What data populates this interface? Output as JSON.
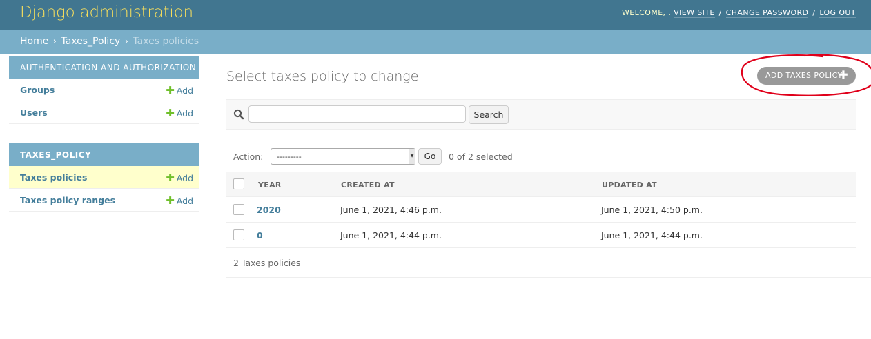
{
  "header": {
    "branding": "Django administration",
    "welcome": "WELCOME, .",
    "view_site": "VIEW SITE",
    "change_password": "CHANGE PASSWORD",
    "log_out": "LOG OUT",
    "separator": "/"
  },
  "breadcrumbs": {
    "home": "Home",
    "app": "Taxes_Policy",
    "current": "Taxes policies",
    "separator": "›"
  },
  "sidebar": {
    "modules": [
      {
        "caption": "AUTHENTICATION AND AUTHORIZATION",
        "items": [
          {
            "label": "Groups",
            "add": "Add"
          },
          {
            "label": "Users",
            "add": "Add"
          }
        ]
      },
      {
        "caption": "TAXES_POLICY",
        "items": [
          {
            "label": "Taxes policies",
            "add": "Add",
            "current": true
          },
          {
            "label": "Taxes policy ranges",
            "add": "Add"
          }
        ]
      }
    ]
  },
  "content": {
    "title": "Select taxes policy to change",
    "add_button": "ADD TAXES POLICY",
    "search": {
      "button": "Search",
      "value": ""
    },
    "actions": {
      "label": "Action:",
      "selected_option": "---------",
      "go": "Go",
      "selected_count": "0 of 2 selected"
    },
    "table": {
      "headers": [
        "YEAR",
        "CREATED AT",
        "UPDATED AT"
      ],
      "rows": [
        {
          "year": "2020",
          "created": "June 1, 2021, 4:46 p.m.",
          "updated": "June 1, 2021, 4:50 p.m."
        },
        {
          "year": "0",
          "created": "June 1, 2021, 4:44 p.m.",
          "updated": "June 1, 2021, 4:44 p.m."
        }
      ]
    },
    "paginator": "2 Taxes policies"
  },
  "colors": {
    "header_bg": "#417690",
    "branding": "#f5dd5d",
    "breadcrumbs_bg": "#79aec8",
    "link": "#447e9b",
    "add_icon": "#70bf2b",
    "annotation": "#e0001a"
  },
  "icons": [
    "search-icon",
    "plus-icon",
    "chevron-down-icon"
  ]
}
